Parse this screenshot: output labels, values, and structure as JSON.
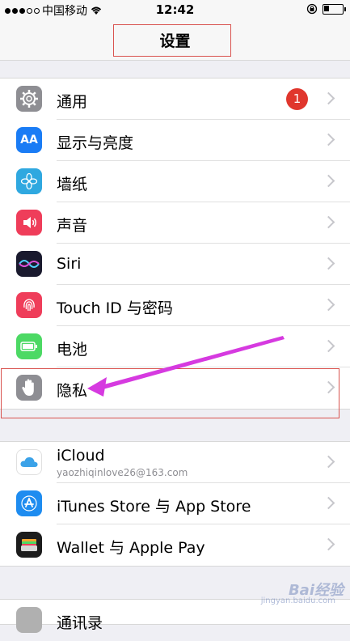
{
  "status_bar": {
    "carrier": "中国移动",
    "time": "12:42",
    "signal_bars_filled": 3,
    "signal_bars_total": 5
  },
  "nav": {
    "title": "设置"
  },
  "colors": {
    "general": "#8e8e93",
    "display": "#1a7cf5",
    "wallpaper": "#2fa8e0",
    "sounds": "#ef3d5a",
    "siri": "#1a1a2e",
    "touchid": "#ef3d5a",
    "battery": "#4cd964",
    "privacy": "#8e8e93",
    "icloud": "#ffffff",
    "itunes": "#1e8cf0",
    "wallet": "#1c1c1c",
    "badge": "#e0362d",
    "annotation": "#d9534f",
    "arrow": "#d63ae0"
  },
  "group1": [
    {
      "icon": "gear-icon",
      "label": "通用",
      "badge": "1"
    },
    {
      "icon": "display-brightness-icon",
      "icon_text": "AA",
      "label": "显示与亮度"
    },
    {
      "icon": "wallpaper-flower-icon",
      "label": "墙纸"
    },
    {
      "icon": "speaker-icon",
      "label": "声音"
    },
    {
      "icon": "siri-icon",
      "label": "Siri"
    },
    {
      "icon": "fingerprint-icon",
      "label": "Touch ID 与密码"
    },
    {
      "icon": "battery-icon",
      "label": "电池"
    },
    {
      "icon": "hand-icon",
      "label": "隐私"
    }
  ],
  "group2": [
    {
      "icon": "cloud-icon",
      "label": "iCloud",
      "sublabel": "yaozhiqinlove26@163.com"
    },
    {
      "icon": "app-store-icon",
      "label": "iTunes Store 与 App Store"
    },
    {
      "icon": "wallet-icon",
      "label": "Wallet 与 Apple Pay"
    }
  ],
  "group3": [
    {
      "icon": "contacts-icon",
      "label": "通讯录"
    }
  ],
  "watermark": {
    "text": "Bai经验",
    "sub": "jingyan.baidu.com"
  }
}
